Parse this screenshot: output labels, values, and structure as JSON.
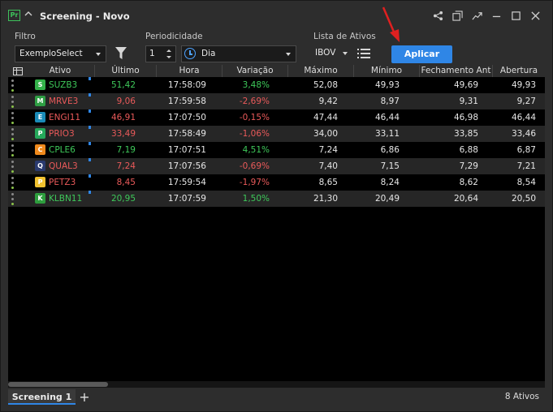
{
  "window": {
    "app_badge": "Pr",
    "title": "Screening - Novo"
  },
  "filters": {
    "filter_label": "Filtro",
    "filter_value": "ExemploSelect",
    "period_label": "Periodicidade",
    "period_count": "1",
    "period_value": "Dia",
    "assets_label": "Lista de Ativos",
    "assets_value": "IBOV",
    "apply_label": "Aplicar"
  },
  "table": {
    "columns": [
      "Ativo",
      "Último",
      "Hora",
      "Variação",
      "Máximo",
      "Mínimo",
      "Fechamento Ant",
      "Abertura"
    ],
    "rows": [
      {
        "ativo": "SUZB3",
        "ultimo": "51,42",
        "hora": "17:58:09",
        "variacao": "3,48%",
        "maximo": "52,08",
        "minimo": "49,93",
        "fechamento": "49,69",
        "abertura": "49,93",
        "trend": "up",
        "logo_color": "#34b24a",
        "logo_text": "S",
        "dot_color": "#8bc34a"
      },
      {
        "ativo": "MRVE3",
        "ultimo": "9,06",
        "hora": "17:59:58",
        "variacao": "-2,69%",
        "maximo": "9,42",
        "minimo": "8,97",
        "fechamento": "9,31",
        "abertura": "9,27",
        "trend": "down",
        "logo_color": "#2f9e44",
        "logo_text": "M",
        "dot_color": "#8bc34a"
      },
      {
        "ativo": "ENGI11",
        "ultimo": "46,91",
        "hora": "17:07:50",
        "variacao": "-0,15%",
        "maximo": "47,44",
        "minimo": "46,44",
        "fechamento": "46,98",
        "abertura": "46,44",
        "trend": "down",
        "logo_color": "#1a8bb8",
        "logo_text": "E",
        "dot_color": "#8bc34a"
      },
      {
        "ativo": "PRIO3",
        "ultimo": "33,49",
        "hora": "17:58:49",
        "variacao": "-1,06%",
        "maximo": "34,00",
        "minimo": "33,11",
        "fechamento": "33,85",
        "abertura": "33,46",
        "trend": "down",
        "logo_color": "#25a85a",
        "logo_text": "P",
        "dot_color": "#8bc34a"
      },
      {
        "ativo": "CPLE6",
        "ultimo": "7,19",
        "hora": "17:07:51",
        "variacao": "4,51%",
        "maximo": "7,24",
        "minimo": "6,86",
        "fechamento": "6,88",
        "abertura": "6,87",
        "trend": "up",
        "logo_color": "#f08a1c",
        "logo_text": "C",
        "dot_color": "#8bc34a"
      },
      {
        "ativo": "QUAL3",
        "ultimo": "7,24",
        "hora": "17:07:56",
        "variacao": "-0,69%",
        "maximo": "7,40",
        "minimo": "7,15",
        "fechamento": "7,29",
        "abertura": "7,21",
        "trend": "down",
        "logo_color": "#2a3a6e",
        "logo_text": "Q",
        "dot_color": "#8bc34a"
      },
      {
        "ativo": "PETZ3",
        "ultimo": "8,45",
        "hora": "17:59:54",
        "variacao": "-1,97%",
        "maximo": "8,65",
        "minimo": "8,24",
        "fechamento": "8,62",
        "abertura": "8,54",
        "trend": "down",
        "logo_color": "#f2c230",
        "logo_text": "P",
        "dot_color": "#8bc34a"
      },
      {
        "ativo": "KLBN11",
        "ultimo": "20,95",
        "hora": "17:07:59",
        "variacao": "1,50%",
        "maximo": "21,30",
        "minimo": "20,49",
        "fechamento": "20,64",
        "abertura": "20,50",
        "trend": "up",
        "logo_color": "#2e9e3e",
        "logo_text": "K",
        "dot_color": "#8bc34a"
      }
    ]
  },
  "tabs": {
    "active": "Screening 1",
    "add": "+"
  },
  "status": {
    "count": "8 Ativos"
  },
  "colors": {
    "accent": "#2f86e6",
    "up": "#3ec95a",
    "down": "#ea5a5a",
    "annotation_arrow": "#e02020"
  }
}
